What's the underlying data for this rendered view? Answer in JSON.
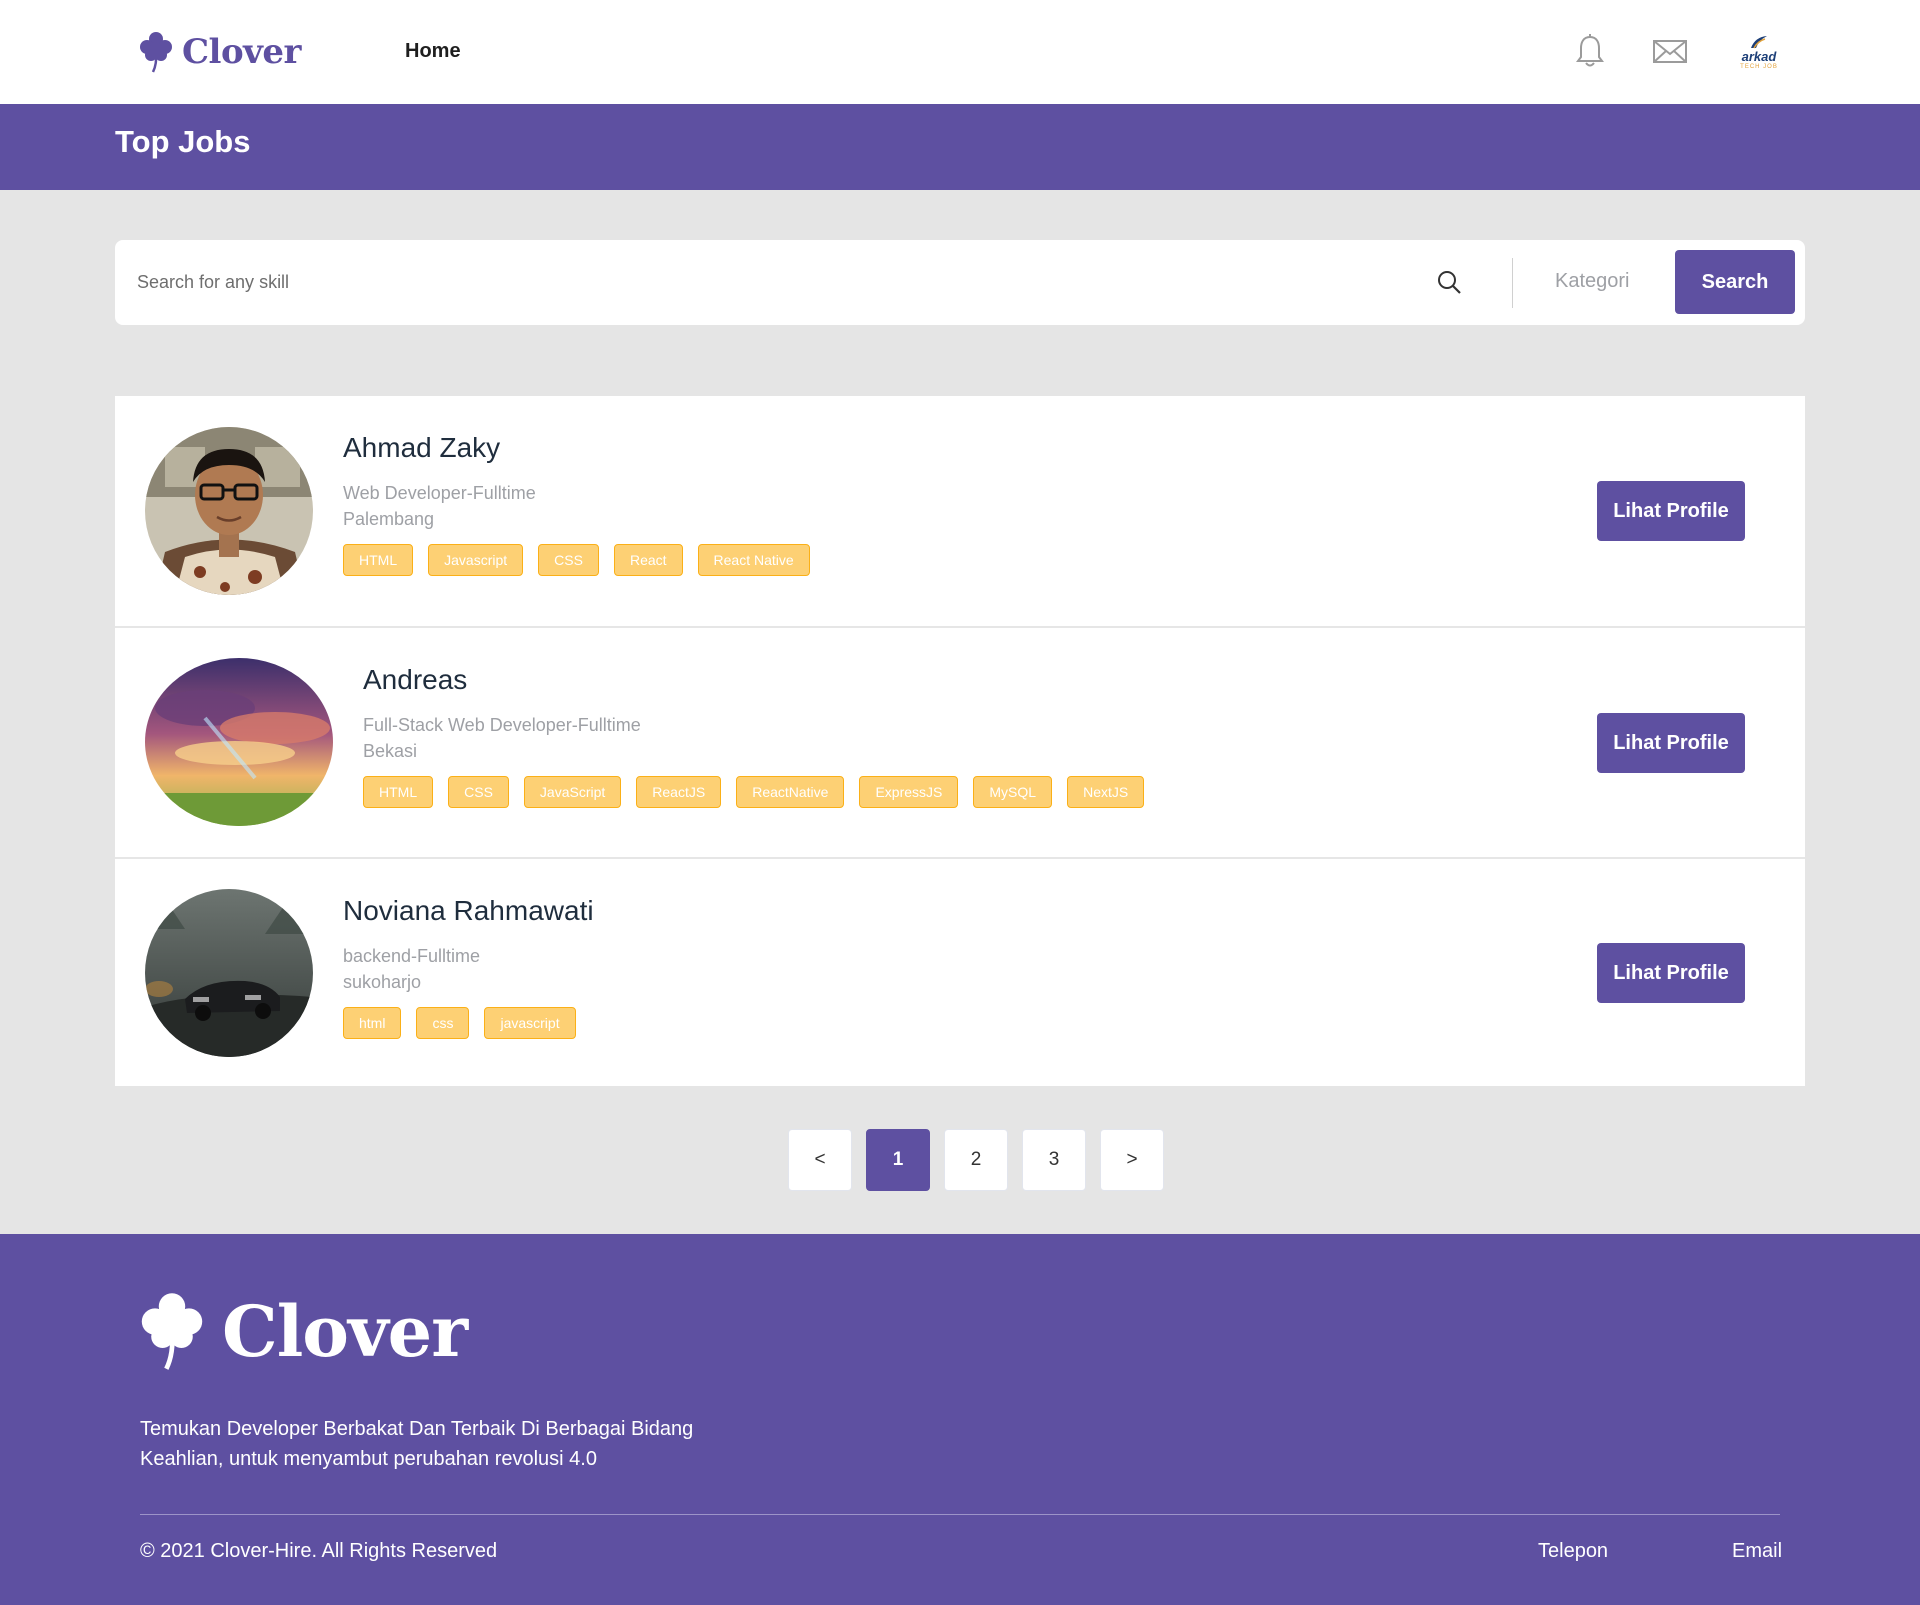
{
  "navbar": {
    "brand": "Clover",
    "home": "Home",
    "avatar_logo": "arkad",
    "avatar_logo_sub": "TECH JOB"
  },
  "banner": {
    "title": "Top Jobs"
  },
  "search": {
    "placeholder": "Search for any skill",
    "category_label": "Kategori",
    "button_label": "Search"
  },
  "developers": [
    {
      "name": "Ahmad Zaky",
      "role": "Web Developer-Fulltime",
      "location": "Palembang",
      "skills": [
        "HTML",
        "Javascript",
        "CSS",
        "React",
        "React Native"
      ],
      "button": "Lihat Profile"
    },
    {
      "name": "Andreas",
      "role": "Full-Stack Web Developer-Fulltime",
      "location": "Bekasi",
      "skills": [
        "HTML",
        "CSS",
        "JavaScript",
        "ReactJS",
        "ReactNative",
        "ExpressJS",
        "MySQL",
        "NextJS"
      ],
      "button": "Lihat Profile"
    },
    {
      "name": "Noviana Rahmawati",
      "role": "backend-Fulltime",
      "location": "sukoharjo",
      "skills": [
        "html",
        "css",
        "javascript"
      ],
      "button": "Lihat Profile"
    }
  ],
  "pagination": {
    "prev": "<",
    "pages": [
      "1",
      "2",
      "3"
    ],
    "active": "1",
    "next": ">"
  },
  "footer": {
    "brand": "Clover",
    "description": "Temukan Developer Berbakat Dan Terbaik Di Berbagai Bidang Keahlian, untuk menyambut perubahan revolusi 4.0",
    "copyright": "© 2021 Clover-Hire. All Rights Reserved",
    "links": {
      "telepon": "Telepon",
      "email": "Email"
    }
  },
  "colors": {
    "primary": "#5e50a1",
    "skill_tag": "#fbb017",
    "page_bg": "#e5e5e5"
  }
}
